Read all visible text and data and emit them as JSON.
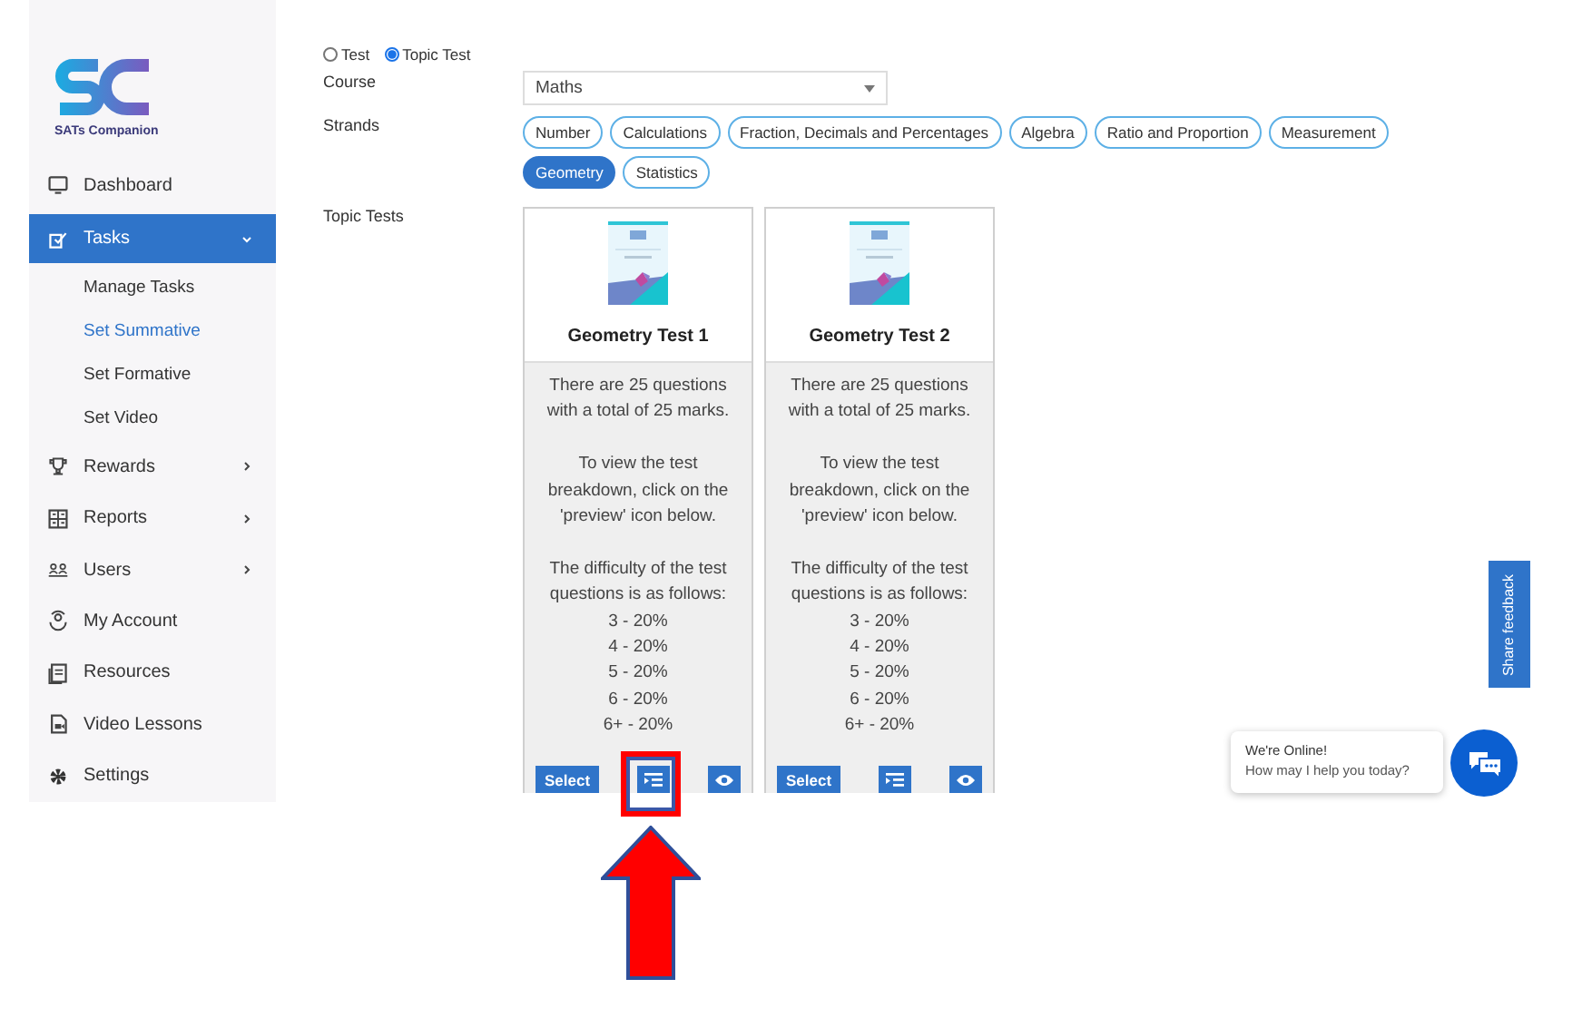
{
  "logo": {
    "caption": "SATs Companion"
  },
  "sidebar": {
    "items": [
      {
        "label": "Dashboard",
        "selected": false,
        "expandable": false
      },
      {
        "label": "Tasks",
        "selected": true,
        "expandable": true,
        "expanded": true,
        "children": [
          {
            "label": "Manage Tasks",
            "selected": false
          },
          {
            "label": "Set Summative",
            "selected": true
          },
          {
            "label": "Set Formative",
            "selected": false
          },
          {
            "label": "Set Video",
            "selected": false
          }
        ]
      },
      {
        "label": "Rewards",
        "selected": false,
        "expandable": true,
        "expanded": false
      },
      {
        "label": "Reports",
        "selected": false,
        "expandable": true,
        "expanded": false
      },
      {
        "label": "Users",
        "selected": false,
        "expandable": true,
        "expanded": false
      },
      {
        "label": "My Account",
        "selected": false,
        "expandable": false
      },
      {
        "label": "Resources",
        "selected": false,
        "expandable": false
      },
      {
        "label": "Video Lessons",
        "selected": false,
        "expandable": false
      },
      {
        "label": "Settings",
        "selected": false,
        "expandable": false
      }
    ]
  },
  "test_type": [
    {
      "label": "Test",
      "selected": false
    },
    {
      "label": "Topic Test",
      "selected": true
    }
  ],
  "course": {
    "label": "Course",
    "value": "Maths"
  },
  "strands": {
    "label": "Strands",
    "chips": [
      {
        "label": "Number",
        "selected": false
      },
      {
        "label": "Calculations",
        "selected": false
      },
      {
        "label": "Fraction, Decimals and Percentages",
        "selected": false
      },
      {
        "label": "Algebra",
        "selected": false
      },
      {
        "label": "Ratio and Proportion",
        "selected": false
      },
      {
        "label": "Measurement",
        "selected": false
      },
      {
        "label": "Geometry",
        "selected": true
      },
      {
        "label": "Statistics",
        "selected": false
      }
    ]
  },
  "topic_tests": {
    "label": "Topic Tests",
    "cards": [
      {
        "title": "Geometry Test 1",
        "paragraphs": [
          "There are 25 questions with a total of 25 marks.",
          "To view the test breakdown, click on the 'preview' icon below.",
          "The difficulty of the test questions is as follows:"
        ],
        "difficulty": [
          "3 - 20%",
          "4 - 20%",
          "5 - 20%",
          "6 - 20%",
          "6+ - 20%"
        ],
        "select_label": "Select",
        "breakdown_highlighted": true
      },
      {
        "title": "Geometry Test 2",
        "paragraphs": [
          "There are 25 questions with a total of 25 marks.",
          "To view the test breakdown, click on the 'preview' icon below.",
          "The difficulty of the test questions is as follows:"
        ],
        "difficulty": [
          "3 - 20%",
          "4 - 20%",
          "5 - 20%",
          "6 - 20%",
          "6+ - 20%"
        ],
        "select_label": "Select",
        "breakdown_highlighted": false
      }
    ]
  },
  "feedback_tab": {
    "label": "Share feedback"
  },
  "chat": {
    "title": "We're Online!",
    "message": "How may I help you today?"
  }
}
